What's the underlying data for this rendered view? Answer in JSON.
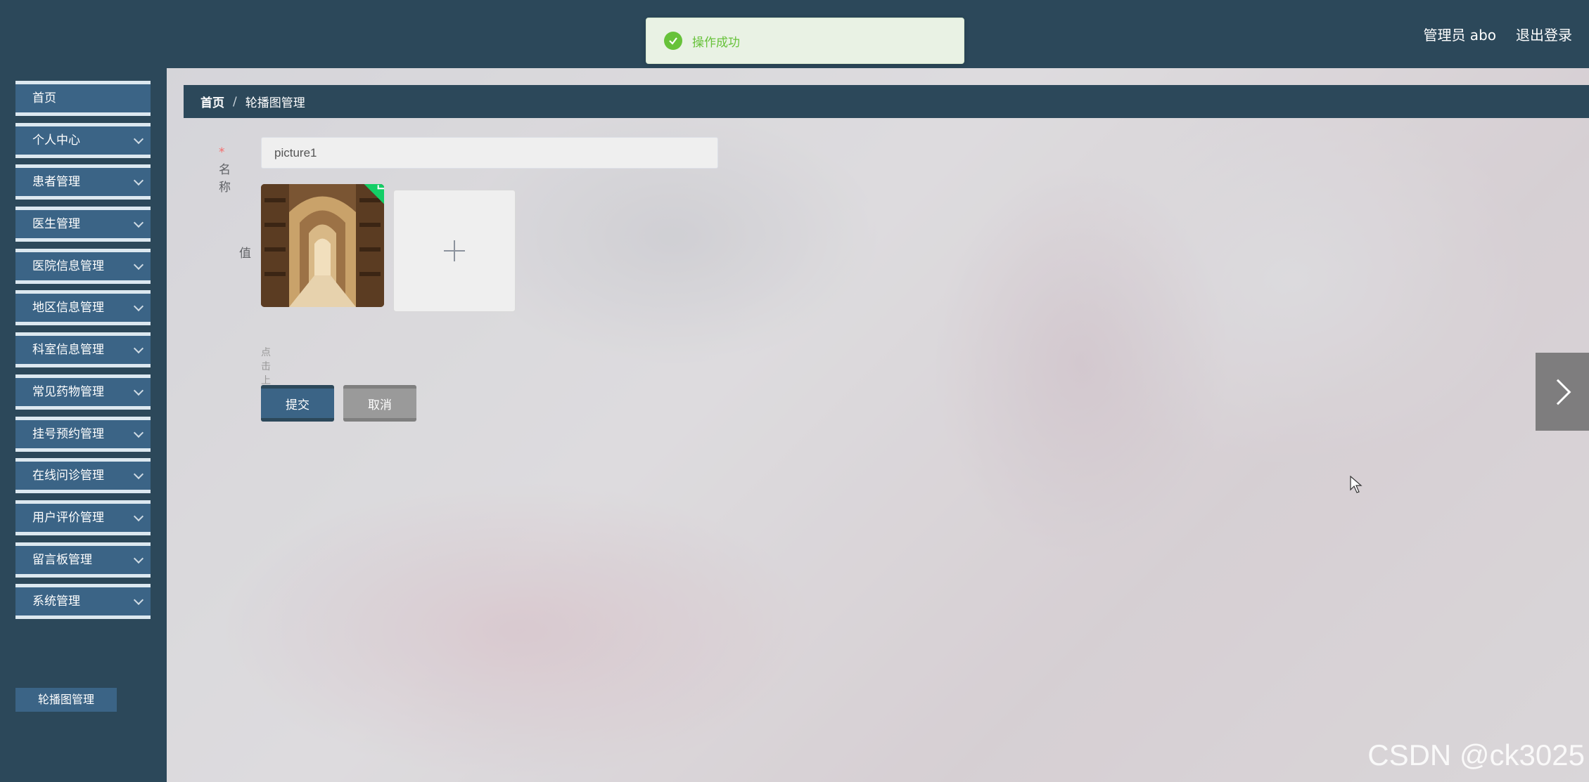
{
  "header": {
    "admin_label": "管理员 abo",
    "logout_label": "退出登录"
  },
  "toast": {
    "message": "操作成功",
    "color": "#67c23a"
  },
  "sidebar": {
    "items": [
      {
        "label": "首页",
        "has_children": false
      },
      {
        "label": "个人中心",
        "has_children": true
      },
      {
        "label": "患者管理",
        "has_children": true
      },
      {
        "label": "医生管理",
        "has_children": true
      },
      {
        "label": "医院信息管理",
        "has_children": true
      },
      {
        "label": "地区信息管理",
        "has_children": true
      },
      {
        "label": "科室信息管理",
        "has_children": true
      },
      {
        "label": "常见药物管理",
        "has_children": true
      },
      {
        "label": "挂号预约管理",
        "has_children": true
      },
      {
        "label": "在线问诊管理",
        "has_children": true
      },
      {
        "label": "用户评价管理",
        "has_children": true
      },
      {
        "label": "留言板管理",
        "has_children": true
      },
      {
        "label": "系统管理",
        "has_children": true
      }
    ],
    "subitem": "轮播图管理"
  },
  "breadcrumb": {
    "home": "首页",
    "separator": "/",
    "current": "轮播图管理"
  },
  "form": {
    "name_label": "名称",
    "name_value": "picture1",
    "value_label": "值",
    "upload_hint": "点击上传值",
    "submit_label": "提交",
    "cancel_label": "取消"
  },
  "watermark": "CSDN @ck3025",
  "colors": {
    "primary": "#3b6486",
    "dark": "#2c485a",
    "success": "#13ce66"
  }
}
